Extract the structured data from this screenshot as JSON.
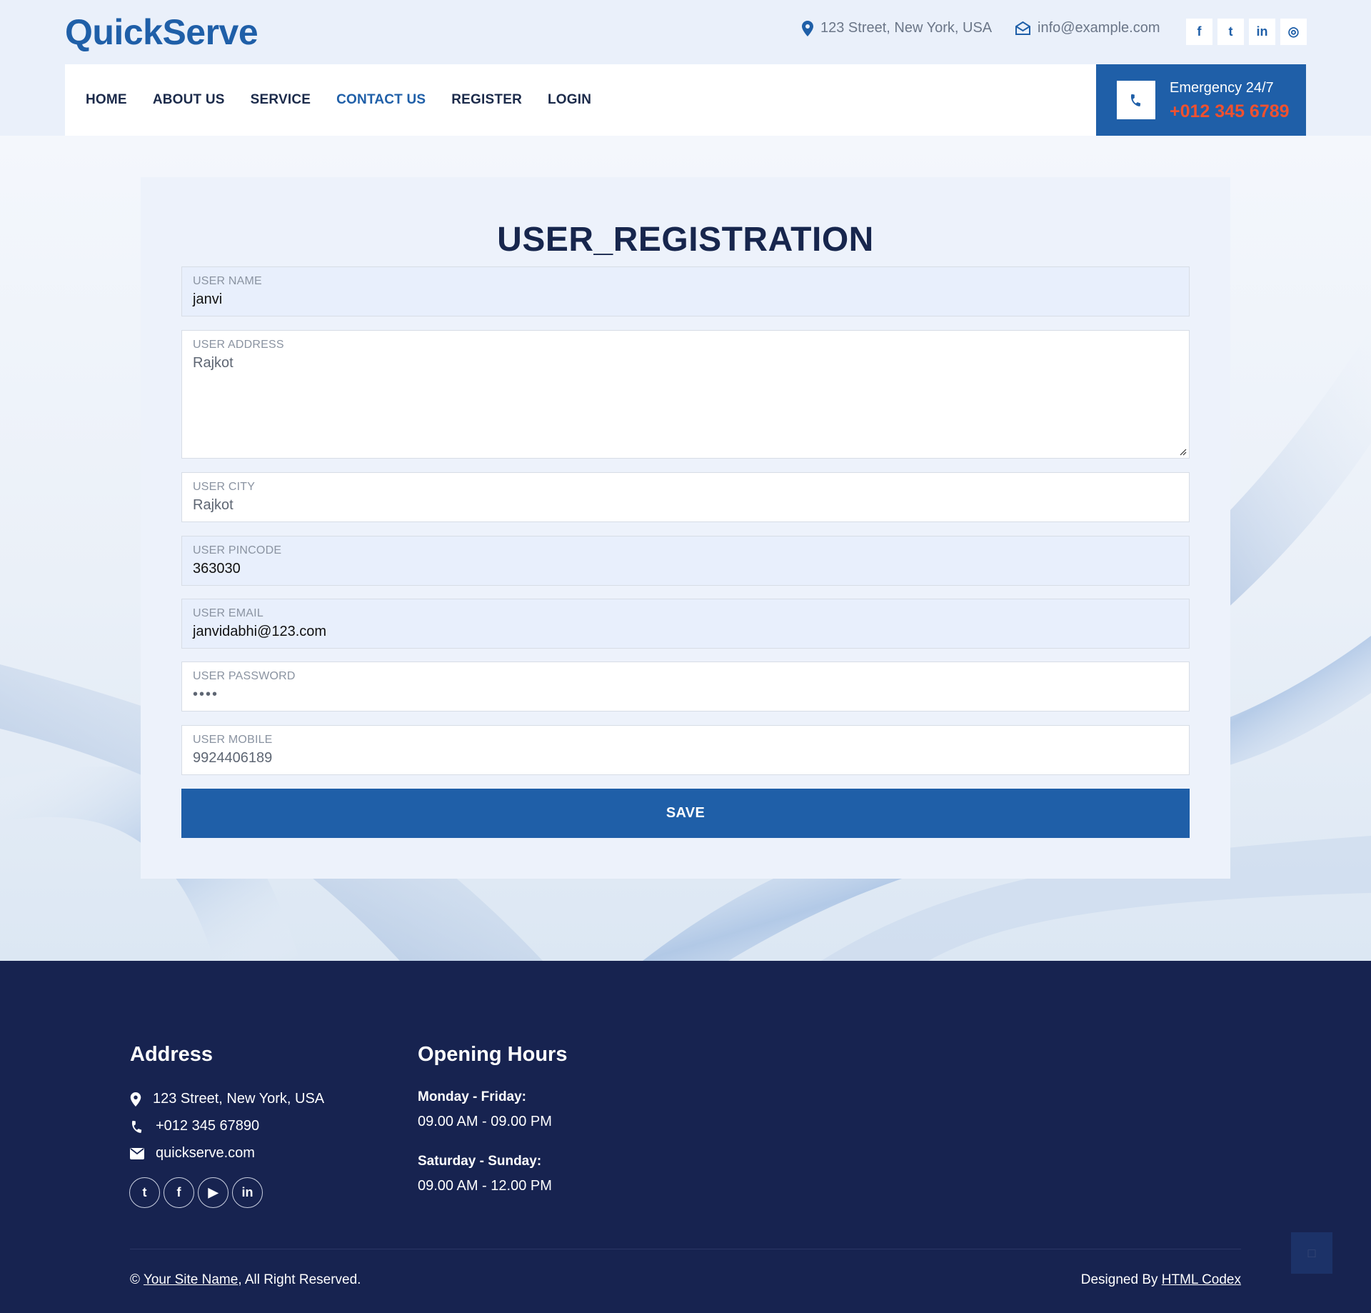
{
  "brand": {
    "logo": "QuickServe",
    "accent": "#1f5fa8",
    "navy": "#172350",
    "emergency_color": "#f0512f"
  },
  "topbar": {
    "address": "123 Street, New York, USA",
    "email": "info@example.com",
    "social": [
      {
        "icon": "facebook-icon",
        "glyph": "f"
      },
      {
        "icon": "twitter-icon",
        "glyph": "t"
      },
      {
        "icon": "linkedin-icon",
        "glyph": "in"
      },
      {
        "icon": "instagram-icon",
        "glyph": "◎"
      }
    ]
  },
  "nav": {
    "items": [
      "HOME",
      "ABOUT US",
      "SERVICE",
      "CONTACT US",
      "REGISTER",
      "LOGIN"
    ],
    "active": "CONTACT US"
  },
  "emergency": {
    "label": "Emergency 24/7",
    "phone": "+012 345 6789"
  },
  "form": {
    "title": "USER_REGISTRATION",
    "fields": [
      {
        "label": "USER NAME",
        "value": "janvi"
      },
      {
        "label": "USER ADDRESS",
        "value": "Rajkot"
      },
      {
        "label": "USER CITY",
        "value": "Rajkot"
      },
      {
        "label": "USER PINCODE",
        "value": "363030"
      },
      {
        "label": "USER EMAIL",
        "value": "janvidabhi@123.com"
      },
      {
        "label": "USER PASSWORD",
        "value": "••••"
      },
      {
        "label": "USER MOBILE",
        "value": "9924406189"
      }
    ],
    "save_label": "SAVE"
  },
  "footer": {
    "address_title": "Address",
    "address": "123 Street, New York, USA",
    "phone": "+012 345 67890",
    "website": "quickserve.com",
    "social": [
      {
        "icon": "twitter-icon",
        "glyph": "t"
      },
      {
        "icon": "facebook-icon",
        "glyph": "f"
      },
      {
        "icon": "youtube-icon",
        "glyph": "▶"
      },
      {
        "icon": "linkedin-icon",
        "glyph": "in"
      }
    ],
    "hours_title": "Opening Hours",
    "weekday_label": "Monday - Friday:",
    "weekday_hours": "09.00 AM - 09.00 PM",
    "weekend_label": "Saturday - Sunday:",
    "weekend_hours": "09.00 AM - 12.00 PM",
    "copyright_prefix": "©",
    "copyright_link": "Your Site Name",
    "copyright_suffix": ", All Right Reserved.",
    "designed_prefix": "Designed By",
    "designed_link": "HTML Codex"
  }
}
